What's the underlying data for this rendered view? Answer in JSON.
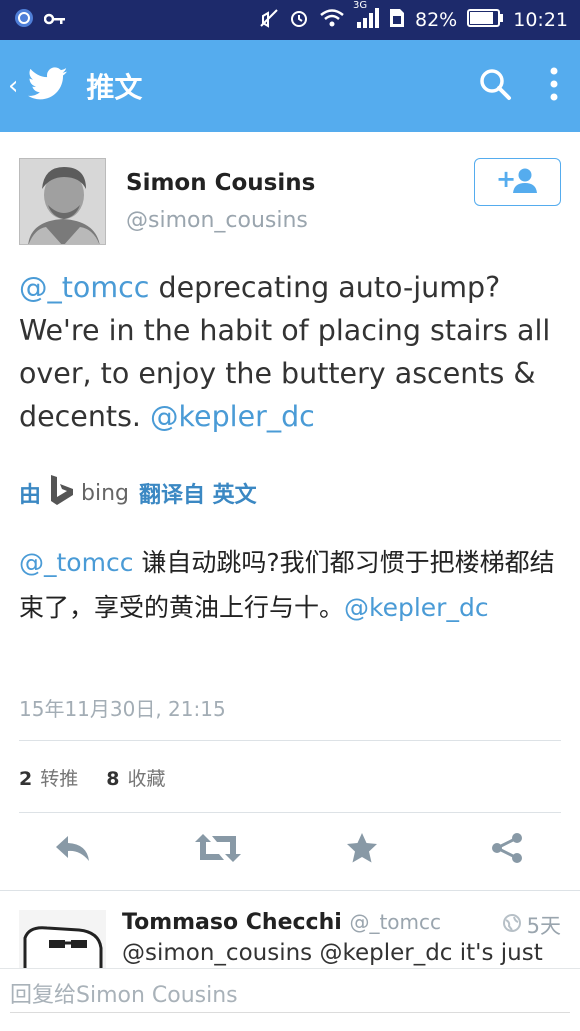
{
  "status_bar": {
    "battery_percent": "82%",
    "time": "10:21",
    "network_label": "3G"
  },
  "app_bar": {
    "title": "推文",
    "back_icon": "chevron-left-icon",
    "logo_icon": "twitter-bird-icon",
    "search_icon": "search-icon",
    "menu_icon": "more-vert-icon"
  },
  "tweet": {
    "author_name": "Simon Cousins",
    "author_handle": "@simon_cousins",
    "text_parts": {
      "mention1": "@_tomcc",
      "body": " deprecating auto-jump? We're in the habit of placing stairs all over, to enjoy the buttery ascents & decents. ",
      "mention2": "@kepler_dc"
    },
    "translate": {
      "by": "由",
      "bing": "bing",
      "link": "翻译自 英文"
    },
    "translated_parts": {
      "mention1": "@_tomcc",
      "body": " 谦自动跳吗?我们都习惯于把楼梯都结束了，享受的黄油上行与十。",
      "mention2": "@kepler_dc"
    },
    "timestamp": "15年11月30日, 21:15",
    "retweets_count": "2",
    "retweets_label": "转推",
    "favorites_count": "8",
    "favorites_label": "收藏"
  },
  "actions": [
    "reply-icon",
    "retweet-icon",
    "star-icon",
    "share-icon"
  ],
  "reply": {
    "name": "Tommaso Checchi",
    "handle": "@_tomcc",
    "time": "5天",
    "text": "@simon_cousins @kepler_dc it's just"
  },
  "composer": {
    "placeholder": "回复给Simon Cousins"
  },
  "colors": {
    "accent": "#55acee",
    "status_bar": "#1d2a6b",
    "mention": "#4a9bd6"
  }
}
